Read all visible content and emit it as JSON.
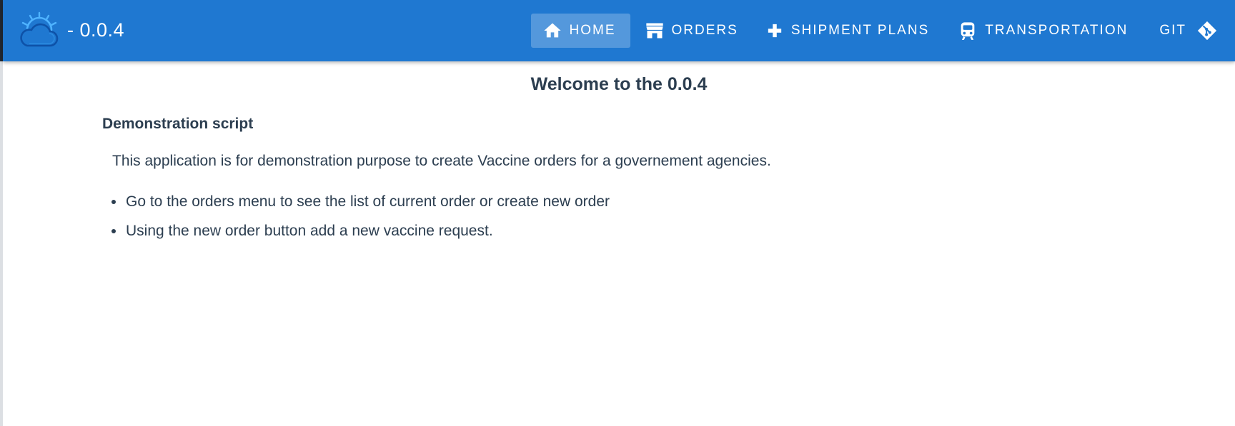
{
  "header": {
    "version": "- 0.0.4",
    "nav": [
      {
        "id": "home",
        "label": "HOME",
        "icon": "home-icon",
        "active": true
      },
      {
        "id": "orders",
        "label": "ORDERS",
        "icon": "store-icon",
        "active": false
      },
      {
        "id": "shipment-plans",
        "label": "SHIPMENT PLANS",
        "icon": "plus-icon",
        "active": false
      },
      {
        "id": "transportation",
        "label": "TRANSPORTATION",
        "icon": "train-icon",
        "active": false
      },
      {
        "id": "git",
        "label": "GIT",
        "icon": "git-icon",
        "active": false
      }
    ]
  },
  "main": {
    "title": "Welcome to the 0.0.4",
    "section_title": "Demonstration script",
    "intro": "This application is for demonstration purpose to create Vaccine orders for a governement agencies.",
    "steps": [
      "Go to the orders menu to see the list of current order or create new order",
      "Using the new order button add a new vaccine request."
    ]
  },
  "colors": {
    "appbar": "#1f78d1",
    "text": "#2c3e50",
    "active_tab": "rgba(255,255,255,0.24)",
    "logo": "#4fb3ff"
  }
}
